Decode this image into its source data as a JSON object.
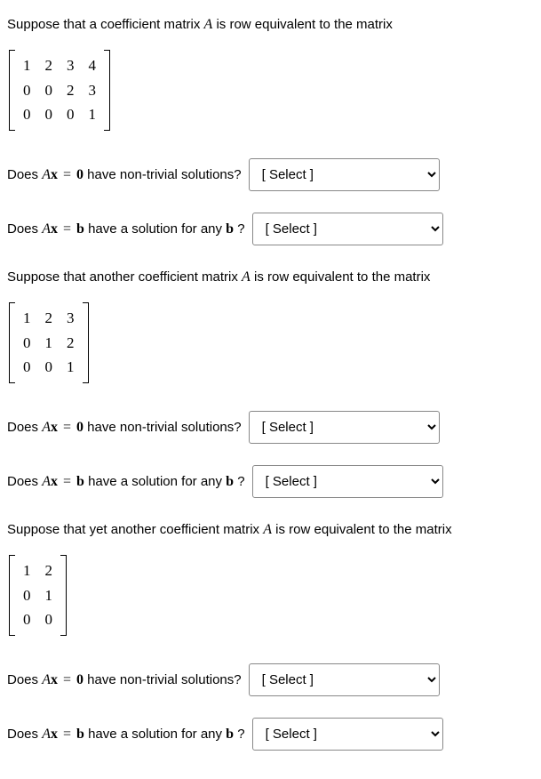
{
  "intro1": {
    "pre": "Suppose that a coefficient matrix ",
    "A": "A",
    "post": " is row equivalent to the matrix"
  },
  "matrix1": [
    [
      "1",
      "2",
      "3",
      "4"
    ],
    [
      "0",
      "0",
      "2",
      "3"
    ],
    [
      "0",
      "0",
      "0",
      "1"
    ]
  ],
  "intro2": {
    "pre": "Suppose that another coefficient matrix ",
    "A": "A",
    "post": " is row equivalent to the matrix"
  },
  "matrix2": [
    [
      "1",
      "2",
      "3"
    ],
    [
      "0",
      "1",
      "2"
    ],
    [
      "0",
      "0",
      "1"
    ]
  ],
  "intro3": {
    "pre": "Suppose that yet another coefficient matrix ",
    "A": "A",
    "post": " is row equivalent to the matrix"
  },
  "matrix3": [
    [
      "1",
      "2"
    ],
    [
      "0",
      "1"
    ],
    [
      "0",
      "0"
    ]
  ],
  "q": {
    "does": "Does ",
    "A": "A",
    "x": "x",
    "eq": " = ",
    "zero": "0",
    "b": "b",
    "nontriv": " have non-trivial solutions? ",
    "anyb_pre": " have a solution for any ",
    "anyb_post": " ? "
  },
  "select_placeholder": "[ Select ]"
}
